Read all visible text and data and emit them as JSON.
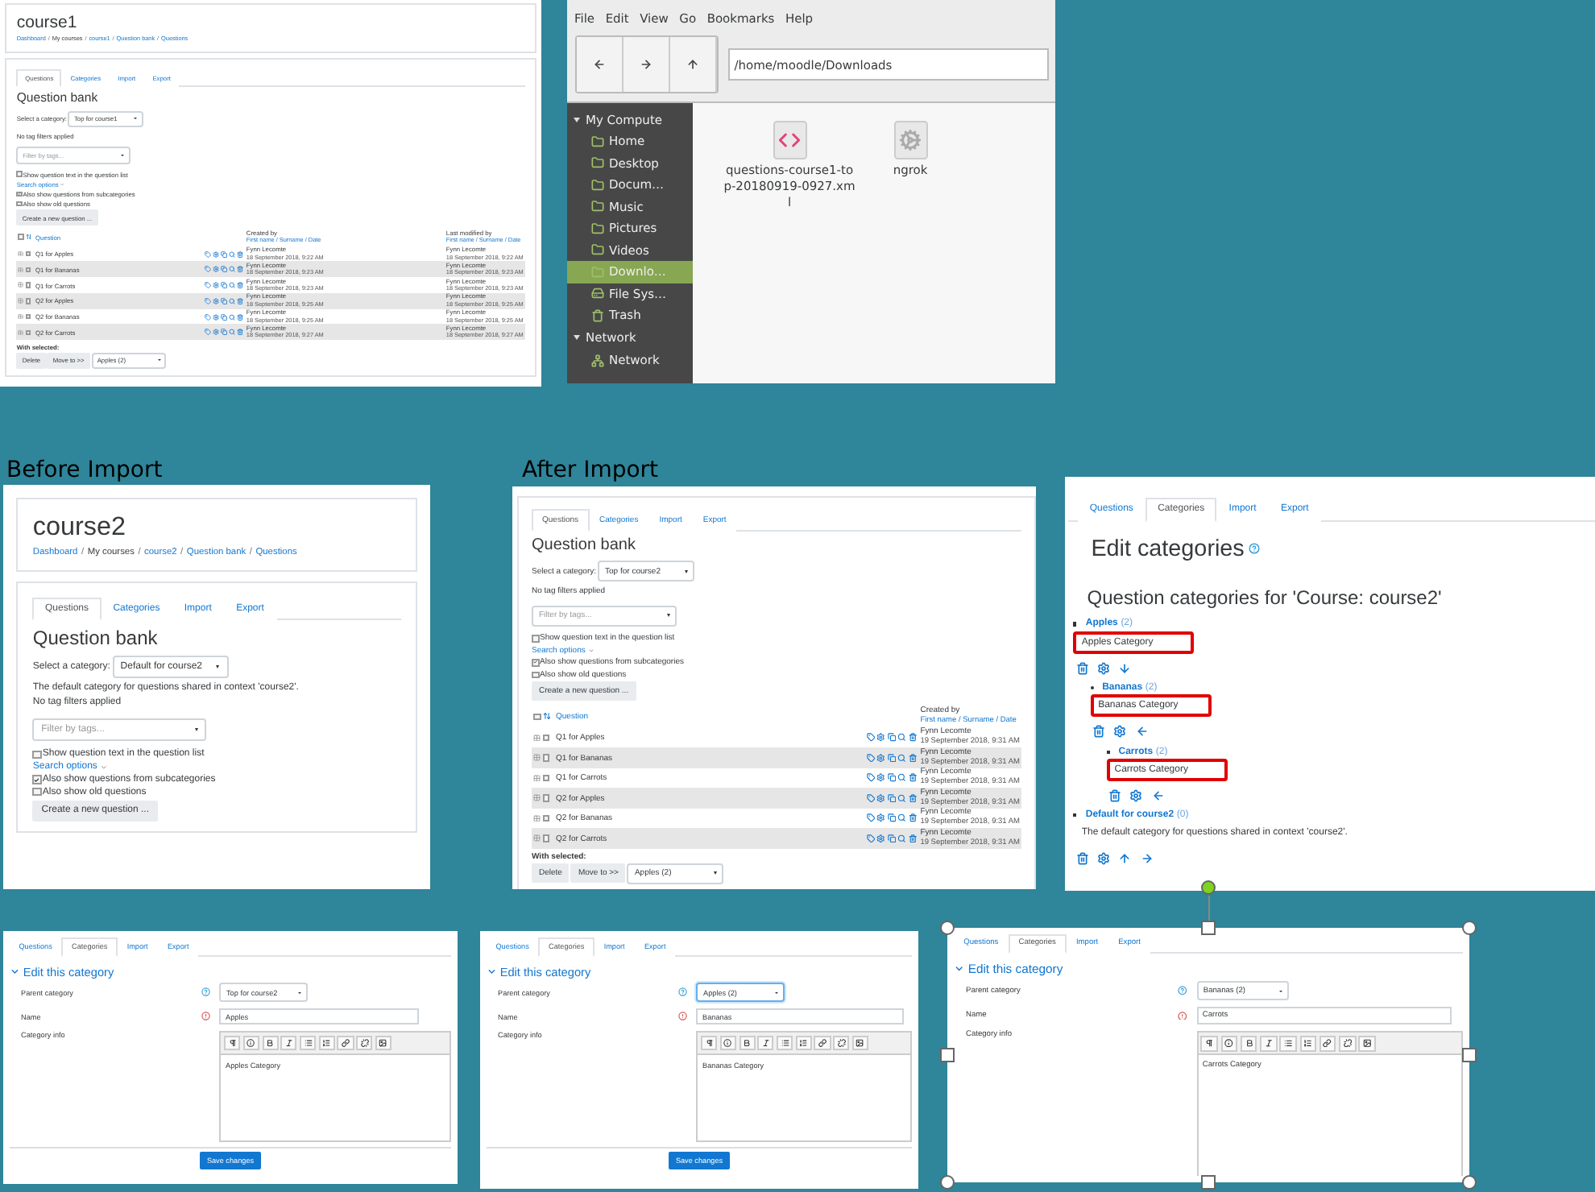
{
  "course1_page": {
    "title": "course1",
    "breadcrumb": [
      {
        "label": "Dashboard",
        "link": true
      },
      {
        "label": "My courses",
        "link": false
      },
      {
        "label": "course1",
        "link": true
      },
      {
        "label": "Question bank",
        "link": true
      },
      {
        "label": "Questions",
        "link": true
      }
    ],
    "breadcrumb_separator": "/",
    "tabs": [
      {
        "label": "Questions",
        "selected": true
      },
      {
        "label": "Categories",
        "selected": false
      },
      {
        "label": "Import",
        "selected": false
      },
      {
        "label": "Export",
        "selected": false
      }
    ],
    "heading": "Question bank",
    "category_label": "Select a category:",
    "category_value": "Top for course1",
    "tag_note": "No tag filters applied",
    "filter_placeholder": "Filter by tags...",
    "options": [
      {
        "kind": "checkbox",
        "label": "Show question text in the question list",
        "checked": false
      },
      {
        "kind": "link",
        "label": "Search options"
      },
      {
        "kind": "checkbox",
        "label": "Also show questions from subcategories",
        "checked": true
      },
      {
        "kind": "checkbox",
        "label": "Also show old questions",
        "checked": false
      }
    ],
    "create_button": "Create a new question ...",
    "table": {
      "all_checked": false,
      "question_column": "Question",
      "created_column": "Created by",
      "created_sort": "First name / Surname / Date",
      "modified_column": "Last modified by",
      "modified_sort": "First name / Surname / Date",
      "rows": [
        {
          "name": "Q1 for Apples",
          "checked": false,
          "created_by": "Fynn Lecomte",
          "created_date": "18 September 2018, 9:22 AM",
          "modified_by": "Fynn Lecomte",
          "modified_date": "18 September 2018, 9:22 AM"
        },
        {
          "name": "Q1 for Bananas",
          "checked": false,
          "created_by": "Fynn Lecomte",
          "created_date": "18 September 2018, 9:23 AM",
          "modified_by": "Fynn Lecomte",
          "modified_date": "18 September 2018, 9:23 AM"
        },
        {
          "name": "Q1 for Carrots",
          "checked": false,
          "created_by": "Fynn Lecomte",
          "created_date": "18 September 2018, 9:23 AM",
          "modified_by": "Fynn Lecomte",
          "modified_date": "18 September 2018, 9:23 AM"
        },
        {
          "name": "Q2 for Apples",
          "checked": false,
          "created_by": "Fynn Lecomte",
          "created_date": "18 September 2018, 9:25 AM",
          "modified_by": "Fynn Lecomte",
          "modified_date": "18 September 2018, 9:25 AM"
        },
        {
          "name": "Q2 for Bananas",
          "checked": false,
          "created_by": "Fynn Lecomte",
          "created_date": "18 September 2018, 9:25 AM",
          "modified_by": "Fynn Lecomte",
          "modified_date": "18 September 2018, 9:25 AM"
        },
        {
          "name": "Q2 for Carrots",
          "checked": false,
          "created_by": "Fynn Lecomte",
          "created_date": "18 September 2018, 9:27 AM",
          "modified_by": "Fynn Lecomte",
          "modified_date": "18 September 2018, 9:27 AM"
        }
      ]
    },
    "with_selected": "With selected:",
    "buttons": [
      "Delete",
      "Move to >>"
    ],
    "move_target": "Apples (2)"
  },
  "file_manager": {
    "menu": [
      "File",
      "Edit",
      "View",
      "Go",
      "Bookmarks",
      "Help"
    ],
    "path": "/home/moodle/Downloads",
    "sidebar": [
      {
        "label": "My Compute",
        "expanded": true,
        "children": [
          {
            "label": "Home",
            "kind": "folder",
            "selected": false
          },
          {
            "label": "Desktop",
            "kind": "folder",
            "selected": false
          },
          {
            "label": "Docum…",
            "kind": "folder",
            "selected": false
          },
          {
            "label": "Music",
            "kind": "folder",
            "selected": false
          },
          {
            "label": "Pictures",
            "kind": "folder",
            "selected": false
          },
          {
            "label": "Videos",
            "kind": "folder",
            "selected": false
          },
          {
            "label": "Downlo…",
            "kind": "folder",
            "selected": true
          },
          {
            "label": "File Sys…",
            "kind": "drive",
            "selected": false
          },
          {
            "label": "Trash",
            "kind": "trash",
            "selected": false
          }
        ]
      },
      {
        "label": "Network",
        "expanded": true,
        "children": [
          {
            "label": "Network",
            "kind": "network",
            "selected": false
          }
        ]
      }
    ],
    "files": [
      {
        "name": "questions-course1-top-20180919-0927.xml",
        "kind": "xml"
      },
      {
        "name": "ngrok",
        "kind": "app"
      }
    ]
  },
  "captions": [
    "Before Import",
    "After Import"
  ],
  "before_page": {
    "title": "course2",
    "breadcrumb": [
      {
        "label": "Dashboard",
        "link": true
      },
      {
        "label": "My courses",
        "link": false
      },
      {
        "label": "course2",
        "link": true
      },
      {
        "label": "Question bank",
        "link": true
      },
      {
        "label": "Questions",
        "link": true
      }
    ],
    "breadcrumb_separator": "/",
    "tabs": [
      {
        "label": "Questions",
        "selected": true
      },
      {
        "label": "Categories",
        "selected": false
      },
      {
        "label": "Import",
        "selected": false
      },
      {
        "label": "Export",
        "selected": false
      }
    ],
    "heading": "Question bank",
    "category_label": "Select a category:",
    "category_value": "Default for course2",
    "description": "The default category for questions shared in context 'course2'.",
    "tag_note": "No tag filters applied",
    "filter_placeholder": "Filter by tags...",
    "options": [
      {
        "kind": "checkbox",
        "label": "Show question text in the question list",
        "checked": false
      },
      {
        "kind": "link",
        "label": "Search options"
      },
      {
        "kind": "checkbox",
        "label": "Also show questions from subcategories",
        "checked": true
      },
      {
        "kind": "checkbox",
        "label": "Also show old questions",
        "checked": false
      }
    ],
    "create_button": "Create a new question ..."
  },
  "after_page": {
    "tabs": [
      {
        "label": "Questions",
        "selected": true
      },
      {
        "label": "Categories",
        "selected": false
      },
      {
        "label": "Import",
        "selected": false
      },
      {
        "label": "Export",
        "selected": false
      }
    ],
    "heading": "Question bank",
    "category_label": "Select a category:",
    "category_value": "Top for course2",
    "tag_note": "No tag filters applied",
    "filter_placeholder": "Filter by tags...",
    "options": [
      {
        "kind": "checkbox",
        "label": "Show question text in the question list",
        "checked": false
      },
      {
        "kind": "link",
        "label": "Search options"
      },
      {
        "kind": "checkbox",
        "label": "Also show questions from subcategories",
        "checked": true
      },
      {
        "kind": "checkbox",
        "label": "Also show old questions",
        "checked": false
      }
    ],
    "create_button": "Create a new question ...",
    "table": {
      "all_checked": false,
      "question_column": "Question",
      "created_column": "Created by",
      "created_sort": "First name / Surname / Date",
      "rows": [
        {
          "name": "Q1 for Apples",
          "checked": false,
          "created_by": "Fynn Lecomte",
          "created_date": "19 September 2018, 9:31 AM"
        },
        {
          "name": "Q1 for Bananas",
          "checked": false,
          "created_by": "Fynn Lecomte",
          "created_date": "19 September 2018, 9:31 AM"
        },
        {
          "name": "Q1 for Carrots",
          "checked": false,
          "created_by": "Fynn Lecomte",
          "created_date": "19 September 2018, 9:31 AM"
        },
        {
          "name": "Q2 for Apples",
          "checked": false,
          "created_by": "Fynn Lecomte",
          "created_date": "19 September 2018, 9:31 AM"
        },
        {
          "name": "Q2 for Bananas",
          "checked": false,
          "created_by": "Fynn Lecomte",
          "created_date": "19 September 2018, 9:31 AM"
        },
        {
          "name": "Q2 for Carrots",
          "checked": false,
          "created_by": "Fynn Lecomte",
          "created_date": "19 September 2018, 9:31 AM"
        }
      ]
    },
    "with_selected": "With selected:",
    "buttons": [
      "Delete",
      "Move to >>"
    ],
    "move_target": "Apples (2)"
  },
  "categories_page": {
    "tabs": [
      {
        "label": "Questions",
        "selected": false
      },
      {
        "label": "Categories",
        "selected": true
      },
      {
        "label": "Import",
        "selected": false
      },
      {
        "label": "Export",
        "selected": false
      }
    ],
    "heading": "Edit categories",
    "subheading": "Question categories for 'Course: course2'",
    "categories": [
      {
        "name": "Apples",
        "count": "(2)",
        "info": "Apples Category",
        "highlighted": true,
        "children": [
          {
            "name": "Bananas",
            "count": "(2)",
            "info": "Bananas Category",
            "highlighted": true,
            "children": [
              {
                "name": "Carrots",
                "count": "(2)",
                "info": "Carrots Category",
                "highlighted": true
              }
            ]
          }
        ]
      },
      {
        "name": "Default for course2",
        "count": "(0)",
        "info": "The default category for questions shared in context 'course2'.",
        "highlighted": false
      }
    ]
  },
  "edit_forms": [
    {
      "tabs": [
        {
          "label": "Questions",
          "selected": false
        },
        {
          "label": "Categories",
          "selected": true
        },
        {
          "label": "Import",
          "selected": false
        },
        {
          "label": "Export",
          "selected": false
        }
      ],
      "legend": "Edit this category",
      "parent_label": "Parent category",
      "parent_value": "Top for course2",
      "name_label": "Name",
      "name_value": "Apples",
      "info_label": "Category info",
      "info_value": "Apples Category",
      "save_button": "Save changes",
      "selected": false
    },
    {
      "tabs": [
        {
          "label": "Questions",
          "selected": false
        },
        {
          "label": "Categories",
          "selected": true
        },
        {
          "label": "Import",
          "selected": false
        },
        {
          "label": "Export",
          "selected": false
        }
      ],
      "legend": "Edit this category",
      "parent_label": "Parent category",
      "parent_value": "Apples (2)",
      "name_label": "Name",
      "name_value": "Bananas",
      "info_label": "Category info",
      "info_value": "Bananas Category",
      "save_button": "Save changes",
      "selected": false
    },
    {
      "tabs": [
        {
          "label": "Questions",
          "selected": false
        },
        {
          "label": "Categories",
          "selected": true
        },
        {
          "label": "Import",
          "selected": false
        },
        {
          "label": "Export",
          "selected": false
        }
      ],
      "legend": "Edit this category",
      "parent_label": "Parent category",
      "parent_value": "Bananas (2)",
      "name_label": "Name",
      "name_value": "Carrots",
      "info_label": "Category info",
      "info_value": "Carrots Category",
      "selected": true
    }
  ]
}
